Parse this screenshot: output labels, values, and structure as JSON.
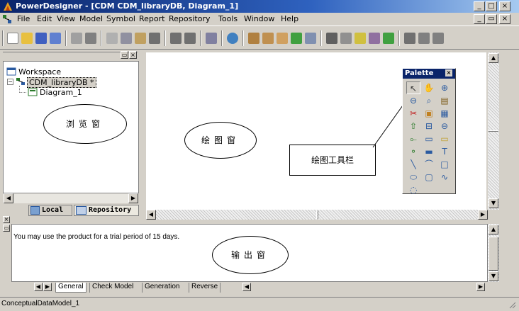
{
  "window": {
    "title": "PowerDesigner - [CDM CDM_libraryDB, Diagram_1]"
  },
  "window_buttons": {
    "min": "_",
    "max": "□",
    "close": "×"
  },
  "doc_buttons": {
    "min": "_",
    "restore": "▭",
    "close": "×"
  },
  "menu": {
    "items": [
      "File",
      "Edit",
      "View",
      "Model",
      "Symbol",
      "Report",
      "Repository",
      "Tools",
      "Window",
      "Help"
    ]
  },
  "browser": {
    "tree": [
      {
        "label": "Workspace",
        "icon": "workspace-icon"
      },
      {
        "label": "CDM_libraryDB *",
        "icon": "model-icon"
      },
      {
        "label": "Diagram_1",
        "icon": "diagram-icon"
      }
    ],
    "annotation": "浏览窗",
    "tabs": [
      "Local",
      "Repository"
    ]
  },
  "canvas": {
    "annotation": "绘图窗"
  },
  "palette": {
    "title": "Palette",
    "annotation": "绘图工具栏",
    "tools": [
      "pointer-tool-icon",
      "grab-tool-icon",
      "zoom-in-tool-icon",
      "zoom-out-tool-icon",
      "zoom-fit-tool-icon",
      "properties-tool-icon",
      "delete-tool-icon",
      "package-tool-icon",
      "entity-tool-icon",
      "inheritance-tool-icon",
      "relationship-tool-icon",
      "association-tool-icon",
      "association-link-tool-icon",
      "file-tool-icon",
      "note-tool-icon",
      "link-tool-icon",
      "assoc-tool-icon",
      "title-tool-icon",
      "line-tool-icon",
      "arc-tool-icon",
      "rectangle-tool-icon",
      "ellipse-tool-icon",
      "rounded-rect-tool-icon",
      "polyline-tool-icon",
      "polygon-tool-icon"
    ],
    "glyphs": [
      "↖",
      "✋",
      "⊕",
      "⊖",
      "⌕",
      "▤",
      "✂",
      "▣",
      "▦",
      "⇧",
      "⊟",
      "⊖",
      "⟜",
      "▭",
      "▭",
      "⚬",
      "▬",
      "T",
      "╲",
      "⌒",
      "□",
      "⬭",
      "▢",
      "∿",
      "◌"
    ]
  },
  "output": {
    "message": "You may use the product for a trial period of 15 days.",
    "annotation": "输出窗",
    "tabs": [
      "General",
      "Check Model",
      "Generation",
      "Reverse"
    ]
  },
  "status": {
    "text": "ConceptualDataModel_1"
  },
  "colors": {
    "chrome": "#d4d0c8",
    "title_gradient_start": "#0a246a",
    "title_gradient_end": "#a6caf0"
  }
}
